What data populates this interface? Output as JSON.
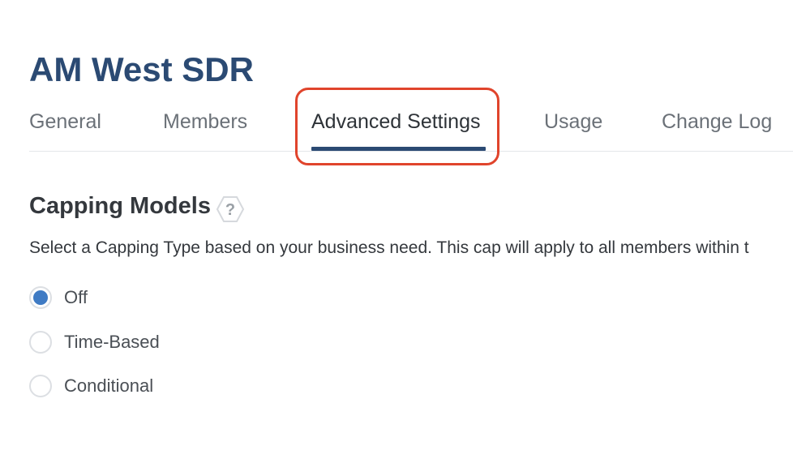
{
  "header": {
    "title": "AM West SDR"
  },
  "tabs": [
    {
      "label": "General",
      "active": false
    },
    {
      "label": "Members",
      "active": false
    },
    {
      "label": "Advanced Settings",
      "active": true
    },
    {
      "label": "Usage",
      "active": false
    },
    {
      "label": "Change Log",
      "active": false
    }
  ],
  "section": {
    "title": "Capping Models",
    "help_icon_glyph": "?",
    "description": "Select a Capping Type based on your business need. This cap will apply to all members within t"
  },
  "capping_options": [
    {
      "label": "Off",
      "selected": true
    },
    {
      "label": "Time-Based",
      "selected": false
    },
    {
      "label": "Conditional",
      "selected": false
    }
  ],
  "colors": {
    "title": "#2b4a73",
    "active_underline": "#2b4a73",
    "highlight_box": "#e0442c",
    "radio_selected": "#3f7bc4"
  }
}
